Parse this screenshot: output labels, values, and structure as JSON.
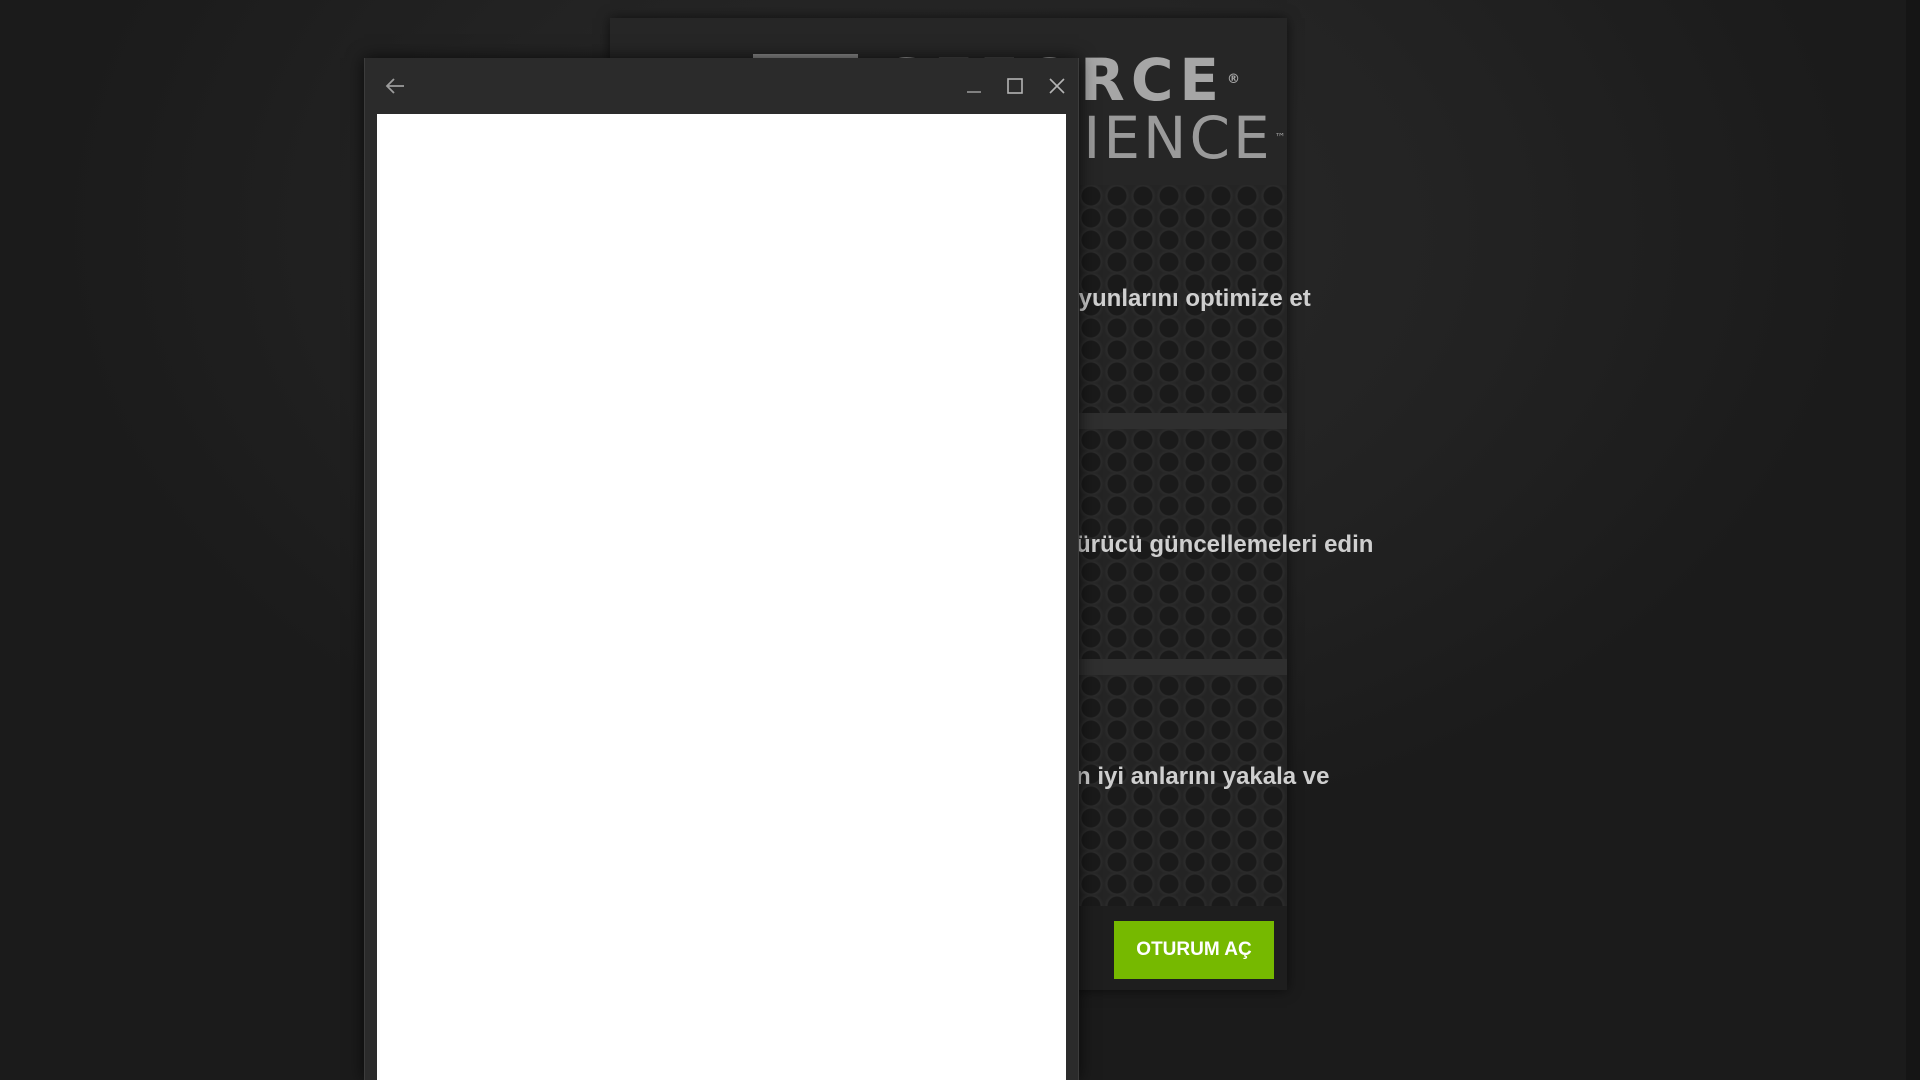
{
  "background_app": {
    "logo": {
      "line1": "GEFORCE",
      "line1_mark": "®",
      "line2": "EXPERIENCE",
      "line2_mark": "™"
    },
    "features": [
      {
        "text": "Oyunlarını optimize et"
      },
      {
        "text": "Sürücü güncellemeleri edin"
      },
      {
        "text": "En iyi anlarını yakala ve"
      }
    ],
    "login_button_label": "OTURUM AÇ"
  },
  "popup": {
    "back_icon": "arrow-left-icon",
    "minimize_icon": "minimize-icon",
    "maximize_icon": "maximize-icon",
    "close_icon": "close-icon",
    "content": ""
  },
  "colors": {
    "accent": "#76b900",
    "background": "#1f1f1f",
    "popup_content": "#ffffff",
    "titlebar": "#2b2b2b"
  }
}
